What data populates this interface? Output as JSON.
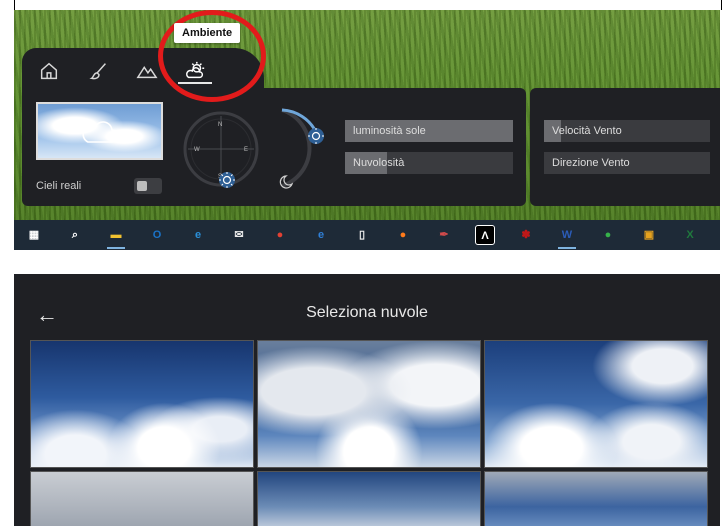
{
  "top": {
    "tooltip": "Ambiente",
    "tabs": [
      {
        "name": "home-icon"
      },
      {
        "name": "brush-icon"
      },
      {
        "name": "mountain-icon"
      },
      {
        "name": "weather-icon",
        "active": true
      }
    ],
    "real_skies_label": "Cieli reali",
    "real_skies_on": false,
    "compass": {
      "n": "N",
      "s": "S",
      "e": "E",
      "w": "W"
    },
    "sliders": {
      "sun_brightness": {
        "label": "luminosità sole",
        "value": 1.0
      },
      "cloudiness": {
        "label": "Nuvolosità",
        "value": 0.25
      },
      "wind_speed": {
        "label": "Velocità Vento",
        "value": 0.1
      },
      "wind_direction": {
        "label": "Direzione Vento",
        "value": 0.0
      }
    },
    "taskbar": [
      "windows-start-icon",
      "search-icon",
      "file-explorer-icon",
      "outlook-icon",
      "edge-icon",
      "mail-icon",
      "chrome-icon",
      "internet-explorer-icon",
      "notepad-icon",
      "firefox-icon",
      "paint-icon",
      "lambda-app-icon",
      "puzzle-app-icon",
      "word-icon",
      "green-app-icon",
      "store-icon",
      "excel-icon"
    ],
    "colors": {
      "accent": "#e21b1b",
      "panel": "#1f2024"
    }
  },
  "bottom": {
    "title": "Seleziona nuvole"
  }
}
